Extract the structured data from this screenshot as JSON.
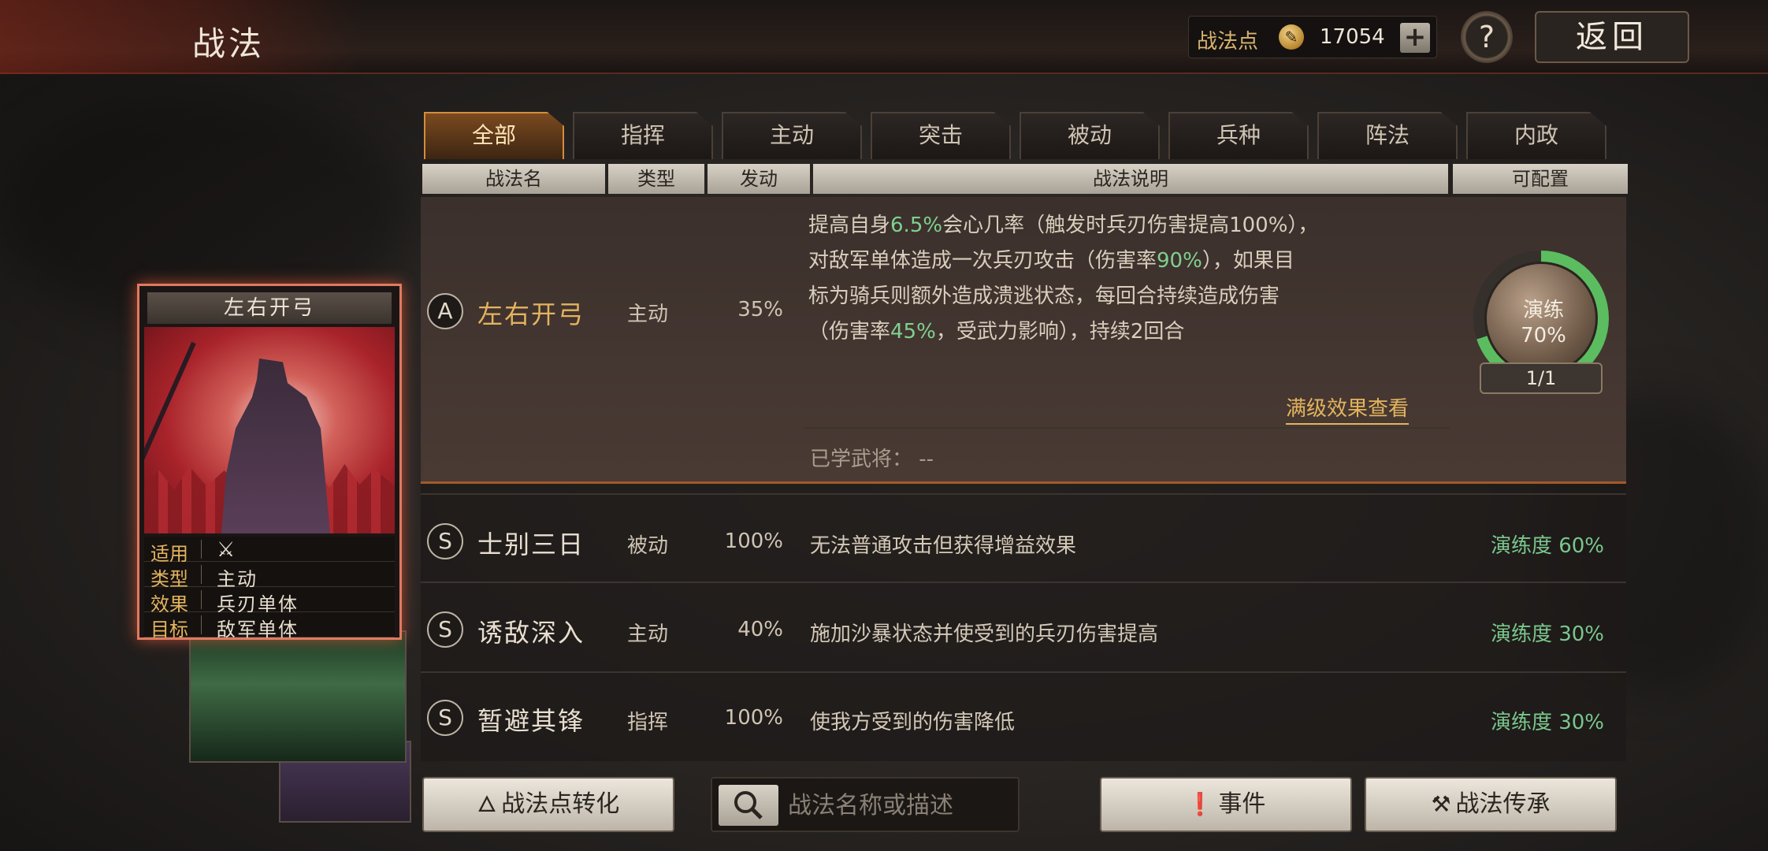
{
  "header": {
    "title": "战法",
    "points_label": "战法点",
    "points_value": "17054",
    "help": "?",
    "back": "返回"
  },
  "tabs": [
    "全部",
    "指挥",
    "主动",
    "突击",
    "被动",
    "兵种",
    "阵法",
    "内政"
  ],
  "columns": {
    "name": "战法名",
    "type": "类型",
    "rate": "发动",
    "desc": "战法说明",
    "config": "可配置"
  },
  "selected": {
    "grade": "A",
    "name": "左右开弓",
    "type": "主动",
    "rate": "35%",
    "desc_lines": [
      [
        "提高自身",
        "6.5%",
        "会心几率（触发时兵刃伤害提高100%），"
      ],
      [
        "对敌军单体造成一次兵刃攻击（伤害率",
        "90%",
        "），如果目"
      ],
      [
        "标为骑兵则额外造成溃逃状态，每回合持续造成伤害",
        "",
        ""
      ],
      [
        "（伤害率",
        "45%",
        "，受武力影响），持续2回合"
      ]
    ],
    "full_effect_link": "满级效果查看",
    "learned": "已学武将：  --",
    "proficiency_label": "演练",
    "proficiency_value": "70%",
    "proficiency": 0.7,
    "count": "1/1"
  },
  "rows": [
    {
      "grade": "S",
      "name": "士别三日",
      "type": "被动",
      "rate": "100%",
      "desc": "无法普通攻击但获得增益效果",
      "prof": "演练度 60%"
    },
    {
      "grade": "S",
      "name": "诱敌深入",
      "type": "主动",
      "rate": "40%",
      "desc": "施加沙暴状态并使受到的兵刃伤害提高",
      "prof": "演练度 30%"
    },
    {
      "grade": "S",
      "name": "暂避其锋",
      "type": "指挥",
      "rate": "100%",
      "desc": "使我方受到的伤害降低",
      "prof": "演练度 30%"
    }
  ],
  "card": {
    "title": "左右开弓",
    "info": [
      {
        "key": "适用",
        "val": ""
      },
      {
        "key": "类型",
        "val": "主动"
      },
      {
        "key": "效果",
        "val": "兵刃单体"
      },
      {
        "key": "目标",
        "val": "敌军单体"
      }
    ]
  },
  "bottom": {
    "convert": "战法点转化",
    "search_placeholder": "战法名称或描述",
    "events": "事件",
    "inherit": "战法传承"
  },
  "colors": {
    "accent_gold": "#e3b45e",
    "highlight_green": "#7fd18f",
    "active_tab": "#d48c3c"
  }
}
